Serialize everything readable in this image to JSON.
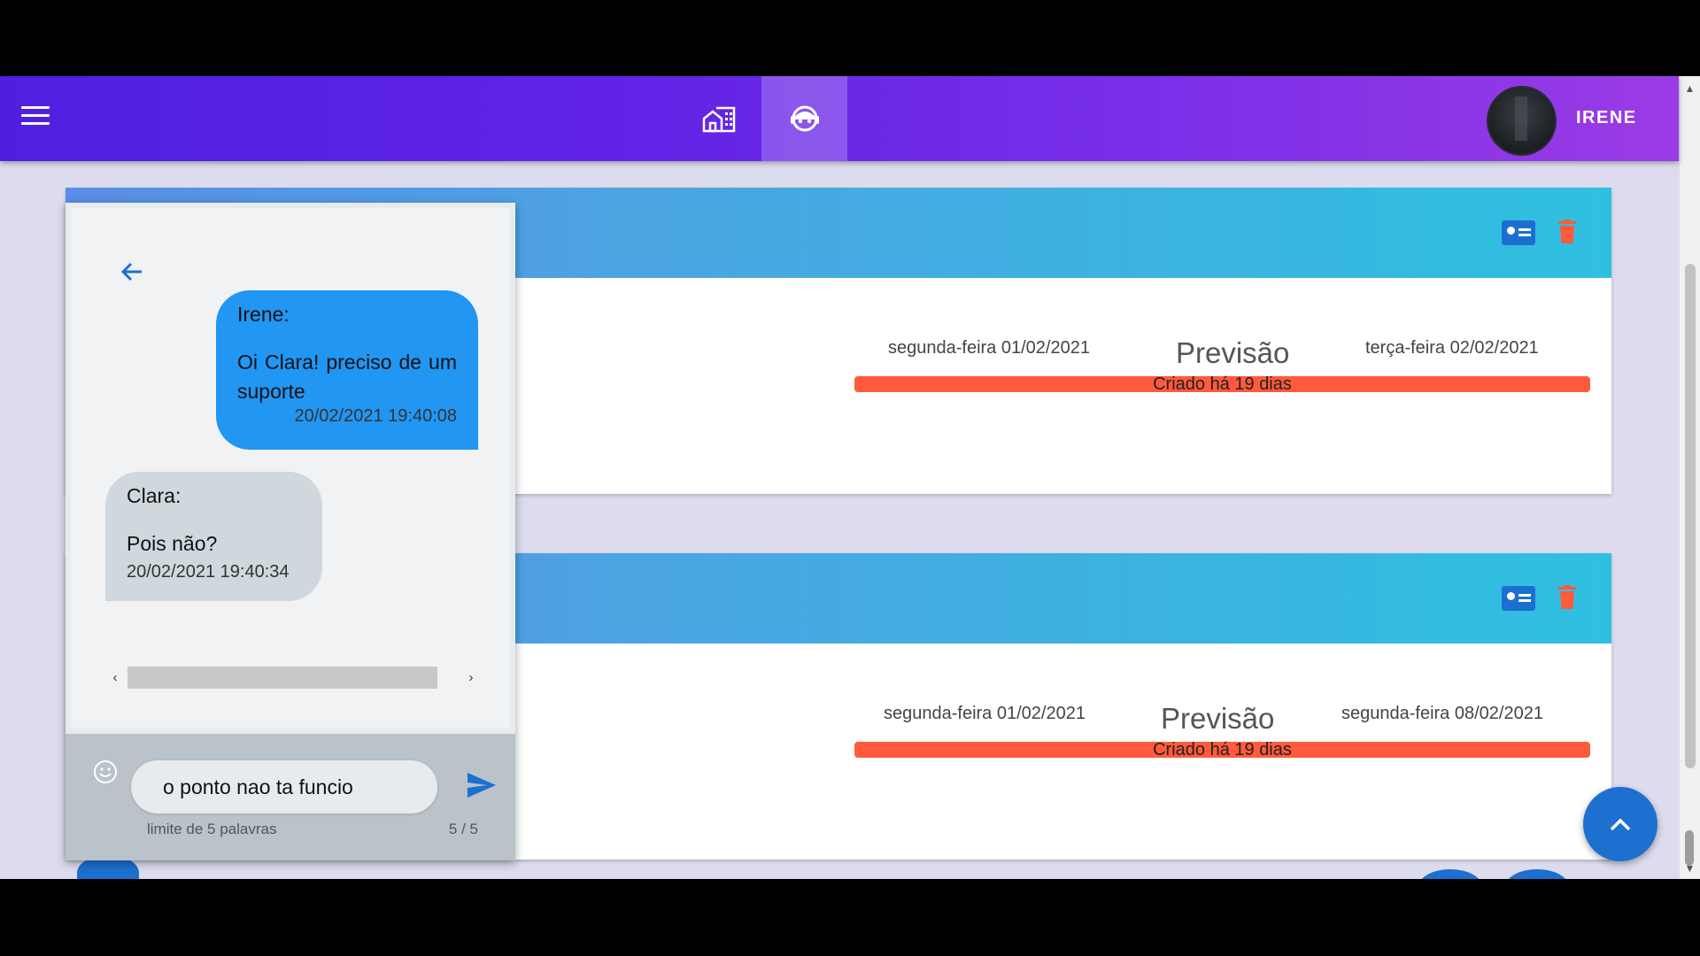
{
  "header": {
    "menu_icon": "menu-icon",
    "nav": [
      {
        "icon": "home-building-icon"
      },
      {
        "icon": "support-agent-icon",
        "active": true
      }
    ],
    "username": "IRENE"
  },
  "cards": [
    {
      "start_date": "segunda-feira 01/02/2021",
      "label": "Previsão",
      "end_date": "terça-feira 02/02/2021",
      "progress_fraction": 1.0,
      "progress_text": "Criado há 19 dias"
    },
    {
      "start_date": "segunda-feira 01/02/2021",
      "label": "Previsão",
      "end_date": "segunda-feira 08/02/2021",
      "progress_fraction": 1.0,
      "progress_text": "Criado há 19 dias"
    }
  ],
  "chat": {
    "messages": [
      {
        "sender": "Irene:",
        "text": "Oi Clara! preciso de um suporte",
        "time": "20/02/2021 19:40:08",
        "direction": "sent"
      },
      {
        "sender": "Clara:",
        "text": "Pois não?",
        "time": "20/02/2021 19:40:34",
        "direction": "received"
      }
    ],
    "input_value": "o ponto nao ta funcio",
    "hint": "limite de 5 palavras",
    "counter": "5 / 5"
  },
  "colors": {
    "appbar_start": "#4f1fe0",
    "appbar_end": "#9b3be6",
    "card_header": "#4aa6e2",
    "progress": "#ff5a3c",
    "sent_bubble": "#2196f3",
    "received_bubble": "#cfd8dc",
    "fab": "#1d6fd0",
    "delete": "#ff5a3c"
  }
}
